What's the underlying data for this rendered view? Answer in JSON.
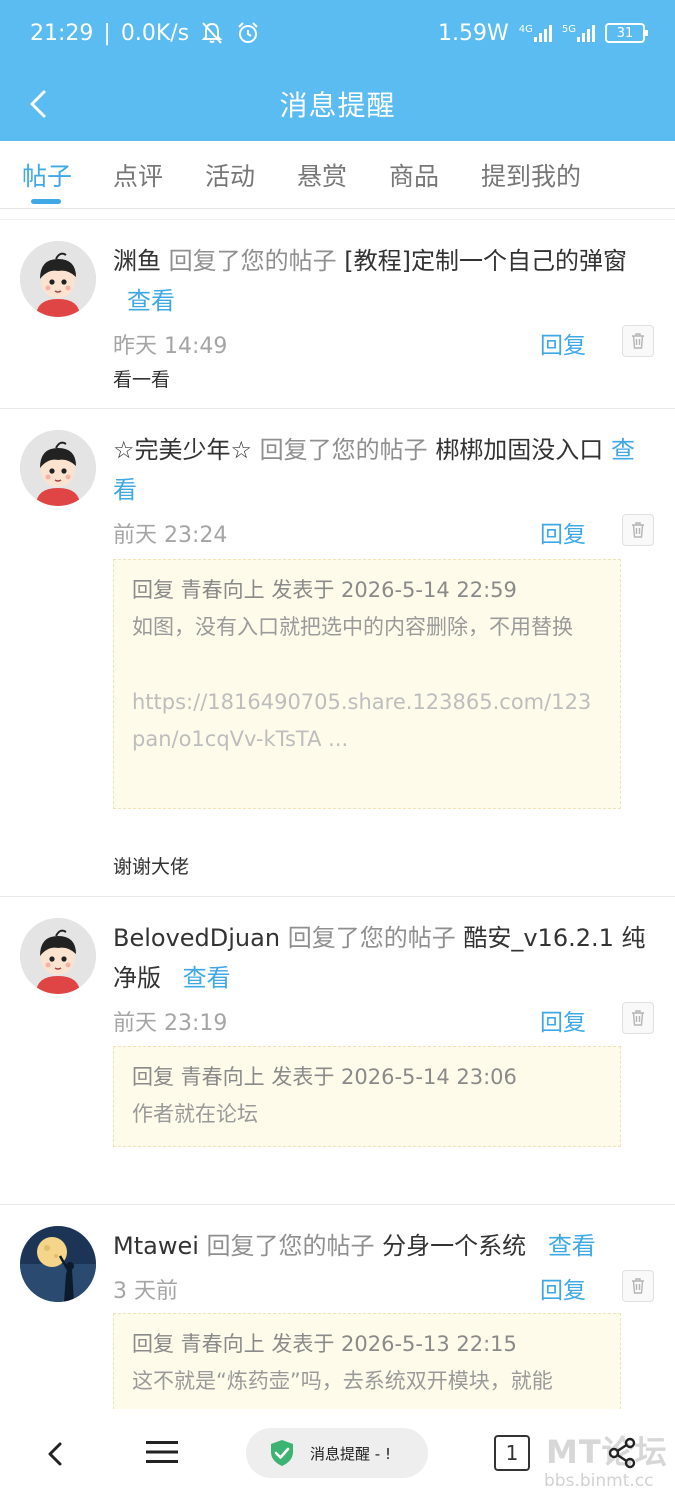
{
  "status_bar": {
    "time": "21:29",
    "speed": "0.0K/s",
    "power": "1.59W",
    "net1": "4G",
    "net2": "5G",
    "battery": "31"
  },
  "header": {
    "title": "消息提醒"
  },
  "tabs": [
    {
      "label": "帖子",
      "active": true
    },
    {
      "label": "点评"
    },
    {
      "label": "活动"
    },
    {
      "label": "悬赏"
    },
    {
      "label": "商品"
    },
    {
      "label": "提到我的"
    }
  ],
  "notifications": [
    {
      "user": "渊鱼",
      "action": "回复了您的帖子",
      "post_title": "[教程]定制一个自己的弹窗",
      "view_label": "查看",
      "time": "昨天 14:49",
      "reply_label": "回复",
      "comment": "看一看"
    },
    {
      "user": "☆完美少年☆",
      "action": "回复了您的帖子",
      "post_title": "梆梆加固没入口",
      "view_label": "查看",
      "time": "前天 23:24",
      "reply_label": "回复",
      "quote_header": "回复 青春向上 发表于 2026-5-14 22:59",
      "quote_body": "如图，没有入口就把选中的内容删除，不用替换",
      "quote_url": "https://1816490705.share.123865.com/123pan/o1cqVv-kTsTA ...",
      "comment": "谢谢大佬"
    },
    {
      "user": "BelovedDjuan",
      "action": "回复了您的帖子",
      "post_title": "酷安_v16.2.1 纯净版",
      "view_label": "查看",
      "time": "前天 23:19",
      "reply_label": "回复",
      "quote_header": "回复 青春向上 发表于 2026-5-14 23:06",
      "quote_body": "作者就在论坛"
    },
    {
      "user": "Mtawei",
      "action": "回复了您的帖子",
      "post_title": "分身一个系统",
      "view_label": "查看",
      "time": "3 天前",
      "reply_label": "回复",
      "quote_header": "回复 青春向上 发表于 2026-5-13 22:15",
      "quote_body": "这不就是“炼药壶”吗，去系统双开模块，就能"
    }
  ],
  "bottom_bar": {
    "tab_label": "消息提醒 - !",
    "tab_count": "1",
    "watermark": "MT论坛",
    "watermark_url": "bbs.binmt.cc"
  },
  "colors": {
    "accent": "#3fa9e6",
    "header_bg": "#5bbcf2",
    "quote_bg": "#fffbeb"
  }
}
